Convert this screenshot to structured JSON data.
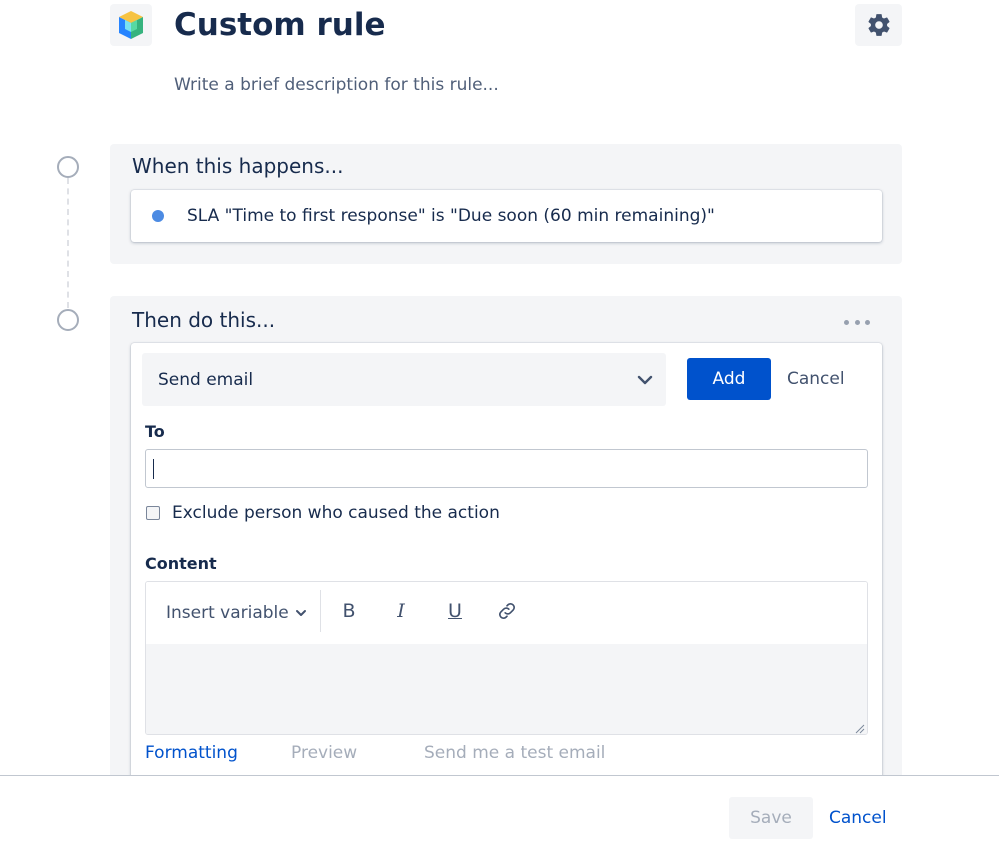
{
  "header": {
    "title": "Custom rule",
    "description_placeholder": "Write a brief description for this rule...",
    "rule_icon": "cube-icon",
    "settings_icon": "gear-icon"
  },
  "trigger": {
    "section_title": "When this happens...",
    "text": "SLA \"Time to first response\" is \"Due soon (60 min remaining)\""
  },
  "action": {
    "section_title": "Then do this...",
    "select_value": "Send email",
    "add_label": "Add",
    "cancel_label": "Cancel",
    "to_label": "To",
    "to_value": "",
    "exclude_label": "Exclude person who caused the action",
    "exclude_checked": false,
    "content_label": "Content",
    "insert_variable_label": "Insert variable",
    "tabs": [
      "Formatting",
      "Preview",
      "Send me a test email"
    ],
    "active_tab": "Formatting"
  },
  "footer": {
    "save_label": "Save",
    "cancel_label": "Cancel"
  },
  "colors": {
    "primary": "#0052CC",
    "text": "#172B4D",
    "muted": "#A5ADBA",
    "section_bg": "#F4F5F7",
    "trigger_bullet": "#4C8BE3"
  }
}
